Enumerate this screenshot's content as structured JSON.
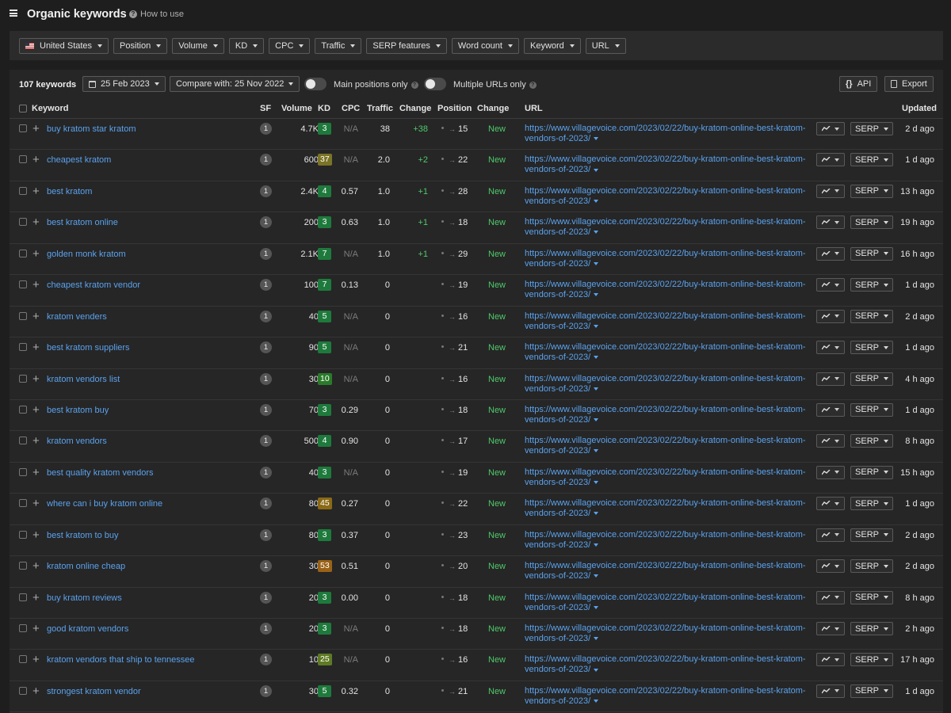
{
  "header": {
    "title": "Organic keywords",
    "how_to_use": "How to use"
  },
  "filters": [
    {
      "label": "United States",
      "icon": "us-flag-icon"
    },
    {
      "label": "Position"
    },
    {
      "label": "Volume"
    },
    {
      "label": "KD"
    },
    {
      "label": "CPC"
    },
    {
      "label": "Traffic"
    },
    {
      "label": "SERP features"
    },
    {
      "label": "Word count"
    },
    {
      "label": "Keyword"
    },
    {
      "label": "URL"
    }
  ],
  "toolbar": {
    "keyword_count": "107 keywords",
    "date": "25 Feb 2023",
    "compare": "Compare with: 25 Nov 2022",
    "main_positions_label": "Main positions only",
    "main_positions_on": false,
    "multiple_urls_label": "Multiple URLs only",
    "multiple_urls_on": false,
    "api_label": "API",
    "export_label": "Export"
  },
  "table": {
    "columns": {
      "keyword": "Keyword",
      "sf": "SF",
      "volume": "Volume",
      "kd": "KD",
      "cpc": "CPC",
      "traffic": "Traffic",
      "change": "Change",
      "position": "Position",
      "position_change": "Change",
      "url": "URL",
      "updated": "Updated"
    },
    "serp_label": "SERP",
    "kd_colors": {
      "green": "#1e7a3c",
      "olive": "#6b7a1e",
      "amber": "#9a6a10"
    },
    "rows": [
      {
        "keyword": "buy kratom star kratom",
        "sf": "1",
        "volume": "4.7K",
        "kd": "3",
        "kd_color": "#1e7a3c",
        "cpc": "N/A",
        "traffic": "38",
        "change": "+38",
        "position": "15",
        "position_change": "New",
        "url": "https://www.villagevoice.com/2023/02/22/buy-kratom-online-best-kratom-vendors-of-2023/",
        "updated": "2 d ago"
      },
      {
        "keyword": "cheapest kratom",
        "sf": "1",
        "volume": "600",
        "kd": "37",
        "kd_color": "#7a7426",
        "cpc": "N/A",
        "traffic": "2.0",
        "change": "+2",
        "position": "22",
        "position_change": "New",
        "url": "https://www.villagevoice.com/2023/02/22/buy-kratom-online-best-kratom-vendors-of-2023/",
        "updated": "1 d ago"
      },
      {
        "keyword": "best kratom",
        "sf": "1",
        "volume": "2.4K",
        "kd": "4",
        "kd_color": "#1e7a3c",
        "cpc": "0.57",
        "traffic": "1.0",
        "change": "+1",
        "position": "28",
        "position_change": "New",
        "url": "https://www.villagevoice.com/2023/02/22/buy-kratom-online-best-kratom-vendors-of-2023/",
        "updated": "13 h ago"
      },
      {
        "keyword": "best kratom online",
        "sf": "1",
        "volume": "200",
        "kd": "3",
        "kd_color": "#1e7a3c",
        "cpc": "0.63",
        "traffic": "1.0",
        "change": "+1",
        "position": "18",
        "position_change": "New",
        "url": "https://www.villagevoice.com/2023/02/22/buy-kratom-online-best-kratom-vendors-of-2023/",
        "updated": "19 h ago"
      },
      {
        "keyword": "golden monk kratom",
        "sf": "1",
        "volume": "2.1K",
        "kd": "7",
        "kd_color": "#1e7a3c",
        "cpc": "N/A",
        "traffic": "1.0",
        "change": "+1",
        "position": "29",
        "position_change": "New",
        "url": "https://www.villagevoice.com/2023/02/22/buy-kratom-online-best-kratom-vendors-of-2023/",
        "updated": "16 h ago"
      },
      {
        "keyword": "cheapest kratom vendor",
        "sf": "1",
        "volume": "100",
        "kd": "7",
        "kd_color": "#1e7a3c",
        "cpc": "0.13",
        "traffic": "0",
        "change": "",
        "position": "19",
        "position_change": "New",
        "url": "https://www.villagevoice.com/2023/02/22/buy-kratom-online-best-kratom-vendors-of-2023/",
        "updated": "1 d ago"
      },
      {
        "keyword": "kratom venders",
        "sf": "1",
        "volume": "40",
        "kd": "5",
        "kd_color": "#1e7a3c",
        "cpc": "N/A",
        "traffic": "0",
        "change": "",
        "position": "16",
        "position_change": "New",
        "url": "https://www.villagevoice.com/2023/02/22/buy-kratom-online-best-kratom-vendors-of-2023/",
        "updated": "2 d ago"
      },
      {
        "keyword": "best kratom suppliers",
        "sf": "1",
        "volume": "90",
        "kd": "5",
        "kd_color": "#1e7a3c",
        "cpc": "N/A",
        "traffic": "0",
        "change": "",
        "position": "21",
        "position_change": "New",
        "url": "https://www.villagevoice.com/2023/02/22/buy-kratom-online-best-kratom-vendors-of-2023/",
        "updated": "1 d ago"
      },
      {
        "keyword": "kratom vendors list",
        "sf": "1",
        "volume": "30",
        "kd": "10",
        "kd_color": "#2a7a2a",
        "cpc": "N/A",
        "traffic": "0",
        "change": "",
        "position": "16",
        "position_change": "New",
        "url": "https://www.villagevoice.com/2023/02/22/buy-kratom-online-best-kratom-vendors-of-2023/",
        "updated": "4 h ago"
      },
      {
        "keyword": "best kratom buy",
        "sf": "1",
        "volume": "70",
        "kd": "3",
        "kd_color": "#1e7a3c",
        "cpc": "0.29",
        "traffic": "0",
        "change": "",
        "position": "18",
        "position_change": "New",
        "url": "https://www.villagevoice.com/2023/02/22/buy-kratom-online-best-kratom-vendors-of-2023/",
        "updated": "1 d ago"
      },
      {
        "keyword": "kratom vendors",
        "sf": "1",
        "volume": "500",
        "kd": "4",
        "kd_color": "#1e7a3c",
        "cpc": "0.90",
        "traffic": "0",
        "change": "",
        "position": "17",
        "position_change": "New",
        "url": "https://www.villagevoice.com/2023/02/22/buy-kratom-online-best-kratom-vendors-of-2023/",
        "updated": "8 h ago"
      },
      {
        "keyword": "best quality kratom vendors",
        "sf": "1",
        "volume": "40",
        "kd": "3",
        "kd_color": "#1e7a3c",
        "cpc": "N/A",
        "traffic": "0",
        "change": "",
        "position": "19",
        "position_change": "New",
        "url": "https://www.villagevoice.com/2023/02/22/buy-kratom-online-best-kratom-vendors-of-2023/",
        "updated": "15 h ago"
      },
      {
        "keyword": "where can i buy kratom online",
        "sf": "1",
        "volume": "80",
        "kd": "45",
        "kd_color": "#8a6a14",
        "cpc": "0.27",
        "traffic": "0",
        "change": "",
        "position": "22",
        "position_change": "New",
        "url": "https://www.villagevoice.com/2023/02/22/buy-kratom-online-best-kratom-vendors-of-2023/",
        "updated": "1 d ago"
      },
      {
        "keyword": "best kratom to buy",
        "sf": "1",
        "volume": "80",
        "kd": "3",
        "kd_color": "#1e7a3c",
        "cpc": "0.37",
        "traffic": "0",
        "change": "",
        "position": "23",
        "position_change": "New",
        "url": "https://www.villagevoice.com/2023/02/22/buy-kratom-online-best-kratom-vendors-of-2023/",
        "updated": "2 d ago"
      },
      {
        "keyword": "kratom online cheap",
        "sf": "1",
        "volume": "30",
        "kd": "53",
        "kd_color": "#9a6216",
        "cpc": "0.51",
        "traffic": "0",
        "change": "",
        "position": "20",
        "position_change": "New",
        "url": "https://www.villagevoice.com/2023/02/22/buy-kratom-online-best-kratom-vendors-of-2023/",
        "updated": "2 d ago"
      },
      {
        "keyword": "buy kratom reviews",
        "sf": "1",
        "volume": "20",
        "kd": "3",
        "kd_color": "#1e7a3c",
        "cpc": "0.00",
        "traffic": "0",
        "change": "",
        "position": "18",
        "position_change": "New",
        "url": "https://www.villagevoice.com/2023/02/22/buy-kratom-online-best-kratom-vendors-of-2023/",
        "updated": "8 h ago"
      },
      {
        "keyword": "good kratom vendors",
        "sf": "1",
        "volume": "20",
        "kd": "3",
        "kd_color": "#1e7a3c",
        "cpc": "N/A",
        "traffic": "0",
        "change": "",
        "position": "18",
        "position_change": "New",
        "url": "https://www.villagevoice.com/2023/02/22/buy-kratom-online-best-kratom-vendors-of-2023/",
        "updated": "2 h ago"
      },
      {
        "keyword": "kratom vendors that ship to tennessee",
        "sf": "1",
        "volume": "10",
        "kd": "25",
        "kd_color": "#5e7a24",
        "cpc": "N/A",
        "traffic": "0",
        "change": "",
        "position": "16",
        "position_change": "New",
        "url": "https://www.villagevoice.com/2023/02/22/buy-kratom-online-best-kratom-vendors-of-2023/",
        "updated": "17 h ago"
      },
      {
        "keyword": "strongest kratom vendor",
        "sf": "1",
        "volume": "30",
        "kd": "5",
        "kd_color": "#1e7a3c",
        "cpc": "0.32",
        "traffic": "0",
        "change": "",
        "position": "21",
        "position_change": "New",
        "url": "https://www.villagevoice.com/2023/02/22/buy-kratom-online-best-kratom-vendors-of-2023/",
        "updated": "1 d ago"
      }
    ]
  }
}
